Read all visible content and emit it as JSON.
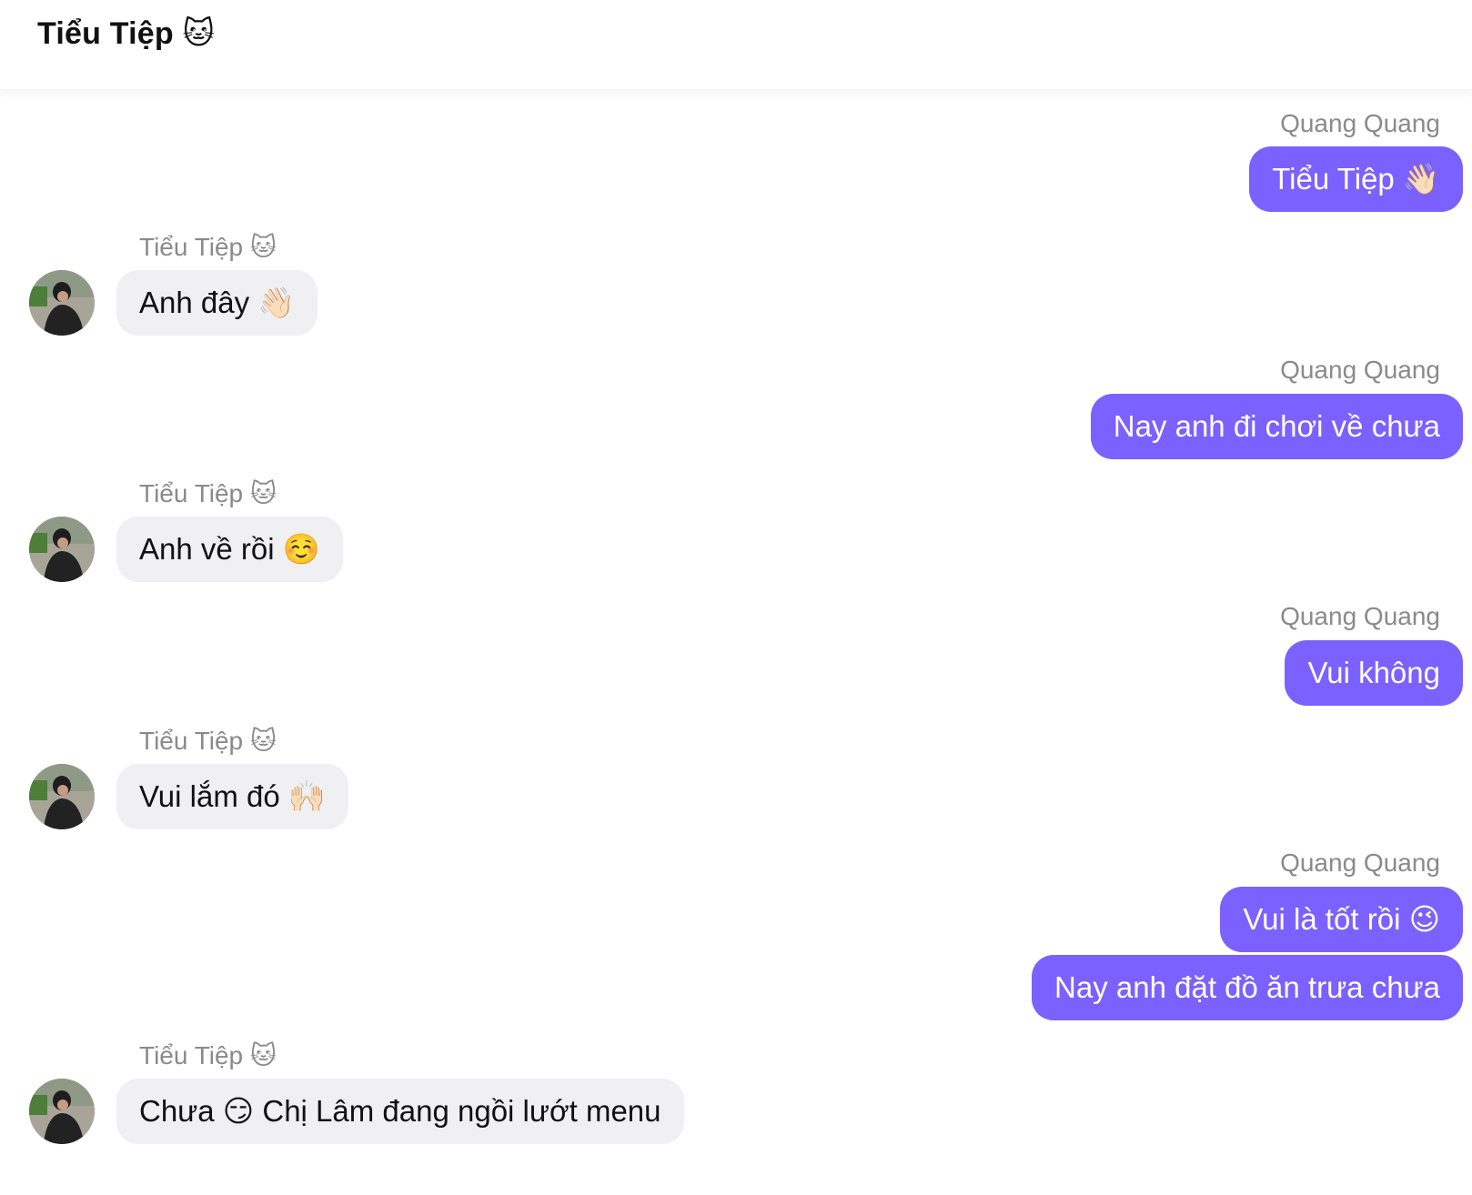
{
  "header": {
    "title": "Tiểu Tiệp 🐱"
  },
  "messages": [
    {
      "side": "out",
      "sender": "Quang Quang",
      "text": "Tiểu Tiệp 👋🏻"
    },
    {
      "side": "in",
      "sender": "Tiểu Tiệp 🐱",
      "text": "Anh đây 👋🏻"
    },
    {
      "side": "out",
      "sender": "Quang Quang",
      "text": "Nay anh đi chơi về chưa"
    },
    {
      "side": "in",
      "sender": "Tiểu Tiệp 🐱",
      "text": "Anh về rồi ☺️"
    },
    {
      "side": "out",
      "sender": "Quang Quang",
      "text": "Vui không"
    },
    {
      "side": "in",
      "sender": "Tiểu Tiệp 🐱",
      "text": "Vui lắm đó 🙌🏻"
    },
    {
      "side": "out",
      "sender": "Quang Quang",
      "text": "Vui là tốt rồi 😉"
    },
    {
      "side": "out",
      "text": "Nay anh đặt đồ ăn trưa chưa"
    },
    {
      "side": "in",
      "sender": "Tiểu Tiệp 🐱",
      "text": "Chưa 😏 Chị Lâm đang ngồi lướt menu"
    }
  ],
  "colors": {
    "outgoing_bubble": "#7b61ff",
    "incoming_bubble": "#f0f0f2",
    "sender_name": "#8a8a8a"
  }
}
